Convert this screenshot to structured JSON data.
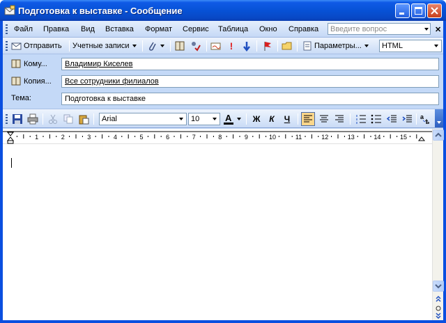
{
  "window": {
    "title": "Подготовка к выставке - Сообщение"
  },
  "menu": {
    "items": [
      {
        "label": "Файл"
      },
      {
        "label": "Правка"
      },
      {
        "label": "Вид"
      },
      {
        "label": "Вставка"
      },
      {
        "label": "Формат"
      },
      {
        "label": "Сервис"
      },
      {
        "label": "Таблица"
      },
      {
        "label": "Окно"
      },
      {
        "label": "Справка"
      }
    ],
    "help_placeholder": "Введите вопрос"
  },
  "toolbar": {
    "send_label": "Отправить",
    "accounts_label": "Учетные записи",
    "options_label": "Параметры...",
    "format_value": "HTML"
  },
  "fields": {
    "to_label": "Кому...",
    "to_value": "Владимир Киселев",
    "cc_label": "Копия...",
    "cc_value": "Все сотрудники филиалов",
    "subject_label": "Тема:",
    "subject_value": "Подготовка к выставке"
  },
  "format": {
    "font_name": "Arial",
    "font_size": "10",
    "bold": "Ж",
    "italic": "К",
    "underline": "Ч"
  },
  "ruler": {
    "numbers": [
      "1",
      "2",
      "3",
      "4",
      "5",
      "6",
      "7",
      "8",
      "9",
      "10",
      "11",
      "12",
      "13",
      "14",
      "15"
    ]
  },
  "colors": {
    "title_bar": "#0752d6",
    "client_bg": "#c4d9f7",
    "active_button": "#fbd68b"
  }
}
